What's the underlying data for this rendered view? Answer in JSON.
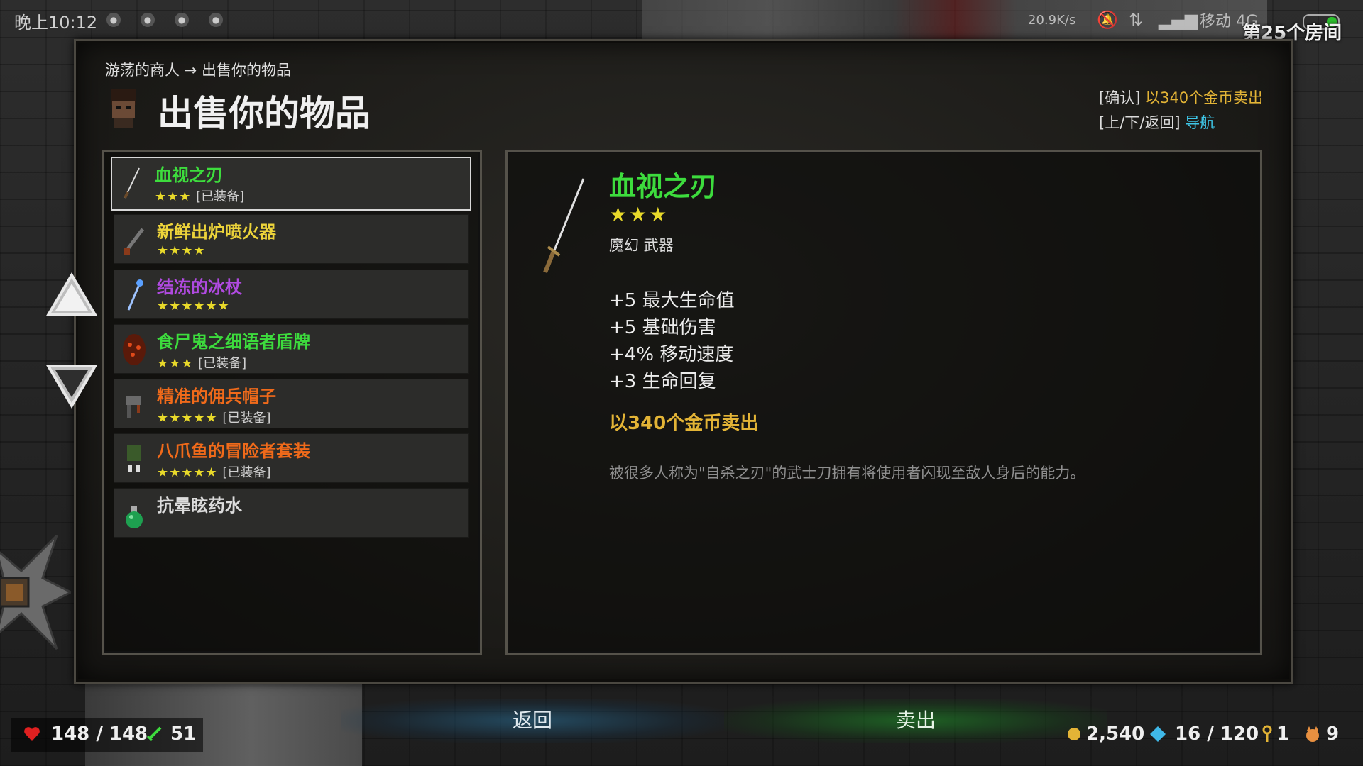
{
  "status_bar": {
    "time": "晚上10:12",
    "net_speed": "20.9K/s",
    "carrier": "移动 4G"
  },
  "room": "第25个房间",
  "breadcrumb": "游荡的商人 → 出售你的物品",
  "title": "出售你的物品",
  "hints": {
    "confirm_key": "[确认]",
    "confirm_action": "以340个金币卖出",
    "nav_key": "[上/下/返回]",
    "nav_action": "导航"
  },
  "items": [
    {
      "name": "血视之刃",
      "stars": "★★★",
      "equipped": "[已装备]",
      "color": "#3ddc3d",
      "icon": "katana-icon"
    },
    {
      "name": "新鲜出炉喷火器",
      "stars": "★★★★",
      "equipped": "",
      "color": "#ecd33a",
      "icon": "flamethrower-icon"
    },
    {
      "name": "结冻的冰杖",
      "stars": "★★★★★★",
      "equipped": "",
      "color": "#b04ae0",
      "icon": "ice-staff-icon"
    },
    {
      "name": "食尸鬼之细语者盾牌",
      "stars": "★★★",
      "equipped": "[已装备]",
      "color": "#3ddc3d",
      "icon": "shield-icon"
    },
    {
      "name": "精准的佣兵帽子",
      "stars": "★★★★★",
      "equipped": "[已装备]",
      "color": "#f06a1a",
      "icon": "hat-icon"
    },
    {
      "name": "八爪鱼的冒险者套装",
      "stars": "★★★★★",
      "equipped": "[已装备]",
      "color": "#f06a1a",
      "icon": "armor-icon"
    },
    {
      "name": "抗晕眩药水",
      "stars": "",
      "equipped": "",
      "color": "#dcdcdc",
      "icon": "potion-icon"
    }
  ],
  "detail": {
    "name": "血视之刃",
    "stars": "★★★",
    "type": "魔幻 武器",
    "stats": [
      "+5 最大生命值",
      "+5 基础伤害",
      "+4% 移动速度",
      "+3 生命回复"
    ],
    "sell_text": "以340个金币卖出",
    "description": "被很多人称为\"自杀之刃\"的武士刀拥有将使用者闪现至敌人身后的能力。"
  },
  "buttons": {
    "back": "返回",
    "sell": "卖出"
  },
  "hud": {
    "health": "148 / 148",
    "attack": "51",
    "gold": "2,540",
    "souls": "16 / 120",
    "keys": "1",
    "pets": "9"
  },
  "colors": {
    "green": "#3ddc3d",
    "gold": "#e3b436",
    "cyan": "#3fc7e8",
    "stars": "#e8d92a"
  }
}
